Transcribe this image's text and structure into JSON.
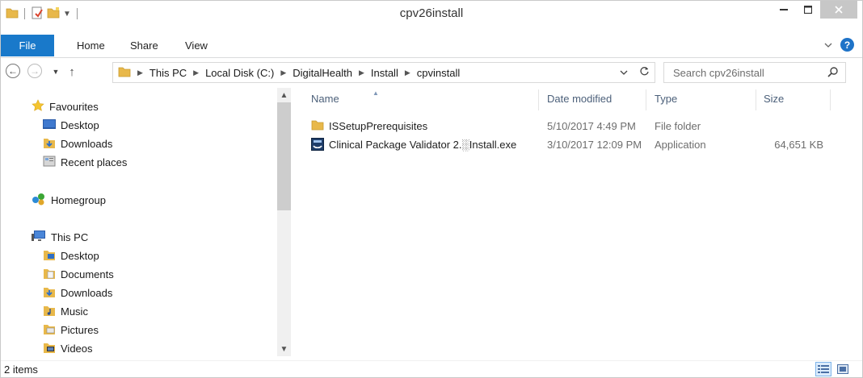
{
  "window": {
    "title": "cpv26install"
  },
  "ribbon": {
    "tabs": [
      "File",
      "Home",
      "Share",
      "View"
    ]
  },
  "address": {
    "crumbs": [
      "This PC",
      "Local Disk (C:)",
      "DigitalHealth",
      "Install",
      "cpvinstall"
    ]
  },
  "search": {
    "placeholder": "Search cpv26install"
  },
  "nav": {
    "favourites": {
      "label": "Favourites",
      "items": [
        "Desktop",
        "Downloads",
        "Recent places"
      ]
    },
    "homegroup": {
      "label": "Homegroup"
    },
    "this_pc": {
      "label": "This PC",
      "items": [
        "Desktop",
        "Documents",
        "Downloads",
        "Music",
        "Pictures",
        "Videos"
      ]
    }
  },
  "list": {
    "columns": {
      "name": "Name",
      "date": "Date modified",
      "type": "Type",
      "size": "Size"
    },
    "rows": [
      {
        "name": "ISSetupPrerequisites",
        "date": "5/10/2017 4:49 PM",
        "type": "File folder",
        "size": "",
        "icon": "folder-icon"
      },
      {
        "name": "Clinical Package Validator 2.░Install.exe",
        "date": "3/10/2017 12:09 PM",
        "type": "Application",
        "size": "64,651 KB",
        "icon": "installer-icon"
      }
    ]
  },
  "status": {
    "items_text": "2 items"
  },
  "colors": {
    "accent": "#1979ca",
    "folder": "#e8b84a",
    "header_text": "#4c607a"
  }
}
